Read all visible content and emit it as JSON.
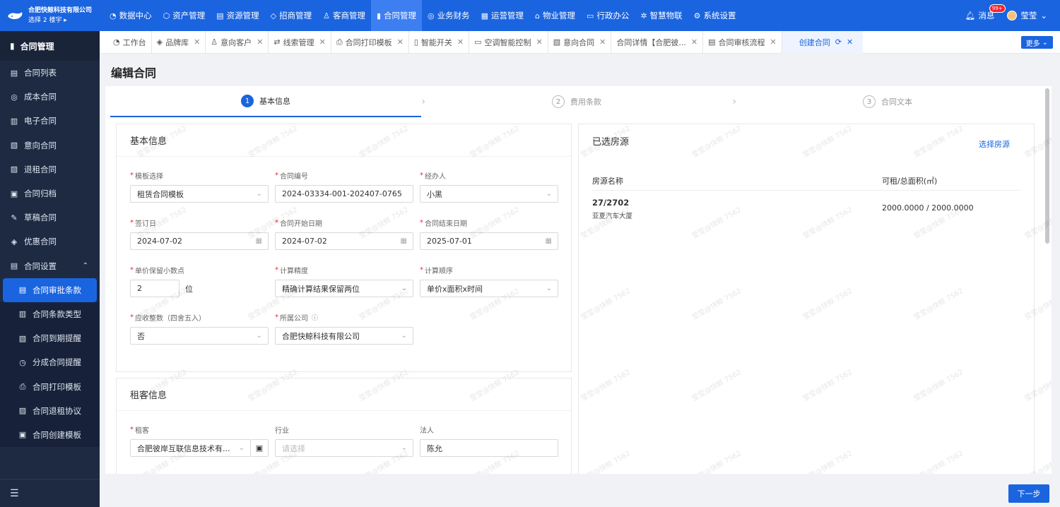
{
  "brand": {
    "name": "合肥快鲸科技有限公司",
    "sub": "选择 2 楼宇 ▸"
  },
  "topnav": [
    {
      "label": "数据中心",
      "icon": "dashboard-icon",
      "glyph": "◔"
    },
    {
      "label": "资产管理",
      "icon": "cube-icon",
      "glyph": "⬡"
    },
    {
      "label": "资源管理",
      "icon": "building-icon",
      "glyph": "▤"
    },
    {
      "label": "招商管理",
      "icon": "tag-icon",
      "glyph": "◇"
    },
    {
      "label": "客商管理",
      "icon": "people-icon",
      "glyph": "♙"
    },
    {
      "label": "合同管理",
      "icon": "document-icon",
      "glyph": "▮"
    },
    {
      "label": "业务财务",
      "icon": "money-icon",
      "glyph": "◎"
    },
    {
      "label": "运营管理",
      "icon": "operation-icon",
      "glyph": "▦"
    },
    {
      "label": "物业管理",
      "icon": "home-icon",
      "glyph": "⌂"
    },
    {
      "label": "行政办公",
      "icon": "monitor-icon",
      "glyph": "▭"
    },
    {
      "label": "智慧物联",
      "icon": "iot-icon",
      "glyph": "✲"
    },
    {
      "label": "系统设置",
      "icon": "gear-icon",
      "glyph": "⚙"
    }
  ],
  "top_right": {
    "message_label": "消息",
    "message_badge": "99+",
    "user_name": "莹莹"
  },
  "sidebar": {
    "header": "合同管理",
    "items": [
      {
        "label": "合同列表",
        "glyph": "▤"
      },
      {
        "label": "成本合同",
        "glyph": "◎"
      },
      {
        "label": "电子合同",
        "glyph": "▥"
      },
      {
        "label": "意向合同",
        "glyph": "▧"
      },
      {
        "label": "退租合同",
        "glyph": "▨"
      },
      {
        "label": "合同归档",
        "glyph": "▣"
      },
      {
        "label": "草稿合同",
        "glyph": "✎"
      },
      {
        "label": "优惠合同",
        "glyph": "◈"
      },
      {
        "label": "合同设置",
        "glyph": "▤"
      }
    ],
    "sub_items": [
      {
        "label": "合同审批条款",
        "glyph": "▤"
      },
      {
        "label": "合同条款类型",
        "glyph": "▥"
      },
      {
        "label": "合同到期提醒",
        "glyph": "▧"
      },
      {
        "label": "分成合同提醒",
        "glyph": "◷"
      },
      {
        "label": "合同打印模板",
        "glyph": "⎙"
      },
      {
        "label": "合同退租协议",
        "glyph": "▨"
      },
      {
        "label": "合同创建模板",
        "glyph": "▣"
      }
    ]
  },
  "tabs": [
    {
      "label": "工作台",
      "glyph": "◔",
      "closable": false
    },
    {
      "label": "品牌库",
      "glyph": "◈",
      "closable": true
    },
    {
      "label": "意向客户",
      "glyph": "♙",
      "closable": true
    },
    {
      "label": "线索管理",
      "glyph": "⇄",
      "closable": true
    },
    {
      "label": "合同打印模板",
      "glyph": "⎙",
      "closable": true
    },
    {
      "label": "智能开关",
      "glyph": "▯",
      "closable": true
    },
    {
      "label": "空调智能控制",
      "glyph": "▭",
      "closable": true
    },
    {
      "label": "意向合同",
      "glyph": "▧",
      "closable": true
    },
    {
      "label": "合同详情【合肥彼...",
      "glyph": "",
      "closable": true
    },
    {
      "label": "合同审核流程",
      "glyph": "▤",
      "closable": true
    },
    {
      "label": "创建合同",
      "glyph": "",
      "closable": true
    }
  ],
  "more_label": "更多",
  "page_title": "编辑合同",
  "steps": [
    {
      "num": "1",
      "label": "基本信息"
    },
    {
      "num": "2",
      "label": "费用条款"
    },
    {
      "num": "3",
      "label": "合同文本"
    }
  ],
  "basic": {
    "title": "基本信息",
    "template": {
      "label": "模板选择",
      "value": "租赁合同模板"
    },
    "contract_no": {
      "label": "合同编号",
      "value": "2024-03334-001-202407-0765"
    },
    "handler": {
      "label": "经办人",
      "value": "小黑"
    },
    "sign_date": {
      "label": "签订日",
      "value": "2024-07-02"
    },
    "start_date": {
      "label": "合同开始日期",
      "value": "2024-07-02"
    },
    "end_date": {
      "label": "合同结束日期",
      "value": "2025-07-01"
    },
    "decimals": {
      "label": "单价保留小数点",
      "value": "2",
      "unit": "位"
    },
    "precision": {
      "label": "计算精度",
      "value": "精确计算结果保留两位"
    },
    "order": {
      "label": "计算顺序",
      "value": "单价x面积x时间"
    },
    "rounding": {
      "label": "应收整数（四舍五入）",
      "value": "否"
    },
    "company": {
      "label": "所属公司",
      "value": "合肥快鲸科技有限公司"
    }
  },
  "tenant": {
    "title": "租客信息",
    "tenant_field": {
      "label": "租客",
      "value": "合肥彼岸互联信息技术有..."
    },
    "industry": {
      "label": "行业",
      "placeholder": "请选择"
    },
    "legal": {
      "label": "法人",
      "value": "陈允"
    }
  },
  "rooms": {
    "title": "已选房源",
    "action": "选择房源",
    "col_name": "房源名称",
    "col_area": "可租/总面积(㎡)",
    "rows": [
      {
        "name": "27/2702",
        "building": "亚夏汽车大厦",
        "area": "2000.0000 / 2000.0000"
      }
    ]
  },
  "next_label": "下一步",
  "watermark": "莹莹@快鲸 7562"
}
